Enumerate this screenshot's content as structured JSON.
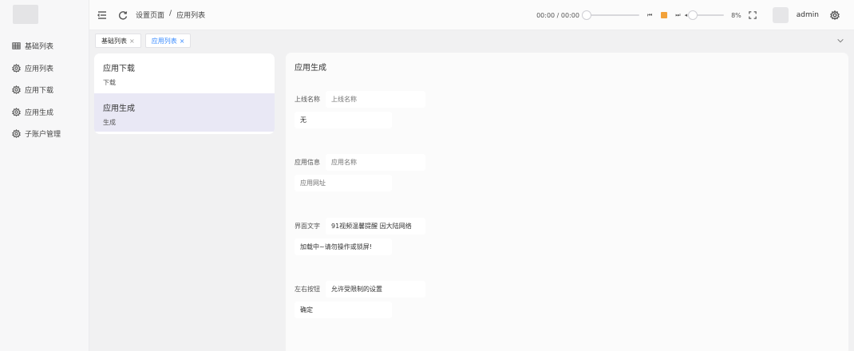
{
  "sidebar": {
    "items": [
      {
        "label": "基础列表",
        "icon": "table-icon"
      },
      {
        "label": "应用列表",
        "icon": "gear-icon"
      },
      {
        "label": "应用下载",
        "icon": "gear-icon"
      },
      {
        "label": "应用生成",
        "icon": "gear-icon"
      },
      {
        "label": "子账户管理",
        "icon": "gear-icon"
      }
    ]
  },
  "header": {
    "breadcrumb": [
      "设置页面",
      "/",
      "应用列表"
    ],
    "player": {
      "time": "00:00 / 00:00",
      "progress": 0,
      "volume_percent": "8%",
      "volume": 0.08
    },
    "username": "admin"
  },
  "tabs": [
    {
      "label": "基础列表",
      "active": false
    },
    {
      "label": "应用列表",
      "active": true
    }
  ],
  "list": [
    {
      "title": "应用下载",
      "subtitle": "下载",
      "selected": false
    },
    {
      "title": "应用生成",
      "subtitle": "生成",
      "selected": true
    }
  ],
  "form": {
    "title": "应用生成",
    "rows": [
      {
        "label": "上线名称",
        "field1": "",
        "field1_placeholder": "上线名称",
        "field2": "无",
        "field2_placeholder": ""
      },
      {
        "label": "应用信息",
        "field1": "",
        "field1_placeholder": "应用名称",
        "field2": "",
        "field2_placeholder": "应用网址"
      },
      {
        "label": "界面文字",
        "field1": "91视频温馨提醒   因大陆网络",
        "field1_placeholder": "",
        "field2": "加载中~请勿操作或锁屏!",
        "field2_placeholder": ""
      },
      {
        "label": "左右按钮",
        "field1": "允许受限制的设置",
        "field1_placeholder": "",
        "field2": "确定",
        "field2_placeholder": ""
      }
    ]
  },
  "colors": {
    "accent": "#3b8cff",
    "selected_bg": "#e9e8f5",
    "play": "#f2a23a"
  }
}
